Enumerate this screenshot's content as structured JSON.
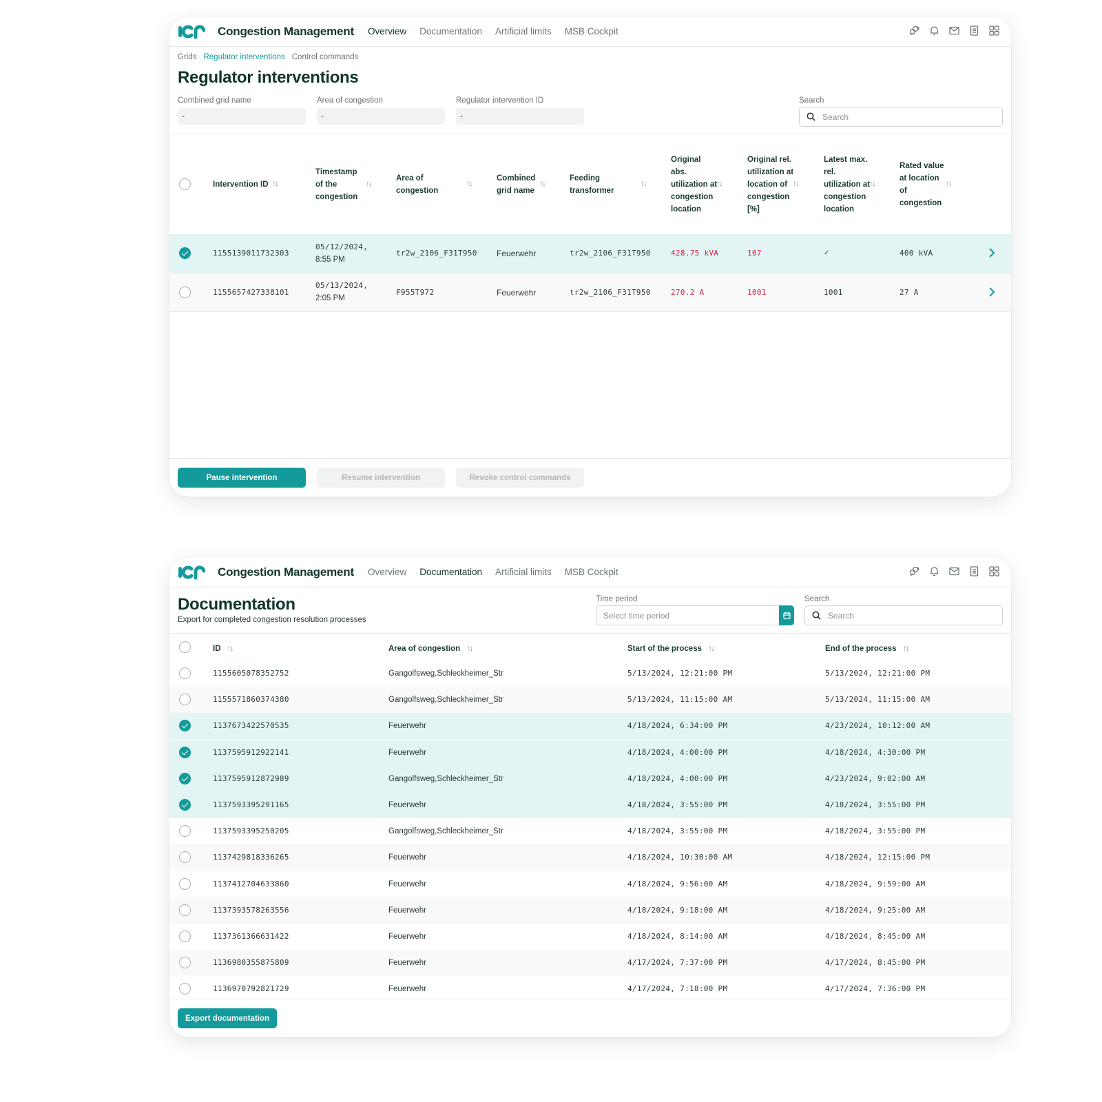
{
  "app": {
    "title": "Congestion Management",
    "logo_text": "IGP",
    "nav": [
      "Overview",
      "Documentation",
      "Artificial limits",
      "MSB Cockpit"
    ],
    "top_icons": [
      "analytics-icon",
      "bell-icon",
      "mail-icon",
      "document-icon",
      "grid-icon"
    ],
    "accent_color": "#149a9a",
    "alert_color": "#c9223f"
  },
  "screen1": {
    "active_nav": "Overview",
    "breadcrumb": [
      "Grids",
      "Regulator interventions",
      "Control commands"
    ],
    "breadcrumb_active": "Regulator interventions",
    "title": "Regulator interventions",
    "filters": [
      {
        "label": "Combined grid name",
        "value": "-"
      },
      {
        "label": "Area of congestion",
        "value": "-"
      },
      {
        "label": "Regulator intervention ID",
        "value": "-"
      }
    ],
    "search": {
      "label": "Search",
      "placeholder": "Search"
    },
    "columns": [
      "Intervention ID",
      "Timestamp of the congestion",
      "Area of congestion",
      "Combined grid name",
      "Feeding transformer",
      "Original abs. utilization at congestion location",
      "Original rel. utilization at location of congestion [%]",
      "Latest max. rel. utilization at congestion location",
      "Rated value at location of congestion"
    ],
    "rows": [
      {
        "selected": true,
        "id": "1155139011732303",
        "timestamp_date": "05/12/2024,",
        "timestamp_time": "8:55 PM",
        "area": "tr2w_2106_F31T950",
        "grid": "Feuerwehr",
        "transformer": "tr2w_2106_F31T950",
        "orig_abs": "428.75 kVA",
        "orig_rel": "107",
        "latest_rel": "✓",
        "rated": "400 kVA"
      },
      {
        "selected": false,
        "id": "1155657427338101",
        "timestamp_date": "05/13/2024,",
        "timestamp_time": "2:05 PM",
        "area": "F955T972",
        "grid": "Feuerwehr",
        "transformer": "tr2w_2106_F31T950",
        "orig_abs": "270.2 A",
        "orig_rel": "1001",
        "latest_rel": "1001",
        "rated": "27 A"
      }
    ],
    "buttons": {
      "pause": "Pause intervention",
      "resume": "Resume intervention",
      "revoke": "Revoke control commands"
    }
  },
  "screen2": {
    "active_nav": "Documentation",
    "title": "Documentation",
    "subtitle": "Export for completed congestion resolution processes",
    "time_period": {
      "label": "Time period",
      "placeholder": "Select time period"
    },
    "search": {
      "label": "Search",
      "placeholder": "Search"
    },
    "columns": [
      "ID",
      "Area of congestion",
      "Start of the process",
      "End of the process"
    ],
    "rows": [
      {
        "selected": false,
        "id": "1155605078352752",
        "area": "Gangolfsweg,Schleckheimer_Str",
        "start": "5/13/2024, 12:21:00 PM",
        "end": "5/13/2024, 12:21:00 PM"
      },
      {
        "selected": false,
        "id": "1155571860374380",
        "area": "Gangolfsweg,Schleckheimer_Str",
        "start": "5/13/2024, 11:15:00 AM",
        "end": "5/13/2024, 11:15:00 AM"
      },
      {
        "selected": true,
        "id": "1137673422570535",
        "area": "Feuerwehr",
        "start": "4/18/2024, 6:34:00 PM",
        "end": "4/23/2024, 10:12:00 AM"
      },
      {
        "selected": true,
        "id": "1137595912922141",
        "area": "Feuerwehr",
        "start": "4/18/2024, 4:00:00 PM",
        "end": "4/18/2024, 4:30:00 PM"
      },
      {
        "selected": true,
        "id": "1137595912872989",
        "area": "Gangolfsweg,Schleckheimer_Str",
        "start": "4/18/2024, 4:00:00 PM",
        "end": "4/23/2024, 9:02:00 AM"
      },
      {
        "selected": true,
        "id": "1137593395291165",
        "area": "Feuerwehr",
        "start": "4/18/2024, 3:55:00 PM",
        "end": "4/18/2024, 3:55:00 PM"
      },
      {
        "selected": false,
        "id": "1137593395250205",
        "area": "Gangolfsweg,Schleckheimer_Str",
        "start": "4/18/2024, 3:55:00 PM",
        "end": "4/18/2024, 3:55:00 PM"
      },
      {
        "selected": false,
        "id": "1137429818336265",
        "area": "Feuerwehr",
        "start": "4/18/2024, 10:30:00 AM",
        "end": "4/18/2024, 12:15:00 PM"
      },
      {
        "selected": false,
        "id": "1137412704633860",
        "area": "Feuerwehr",
        "start": "4/18/2024, 9:56:00 AM",
        "end": "4/18/2024, 9:59:00 AM"
      },
      {
        "selected": false,
        "id": "1137393578263556",
        "area": "Feuerwehr",
        "start": "4/18/2024, 9:18:00 AM",
        "end": "4/18/2024, 9:25:00 AM"
      },
      {
        "selected": false,
        "id": "1137361366631422",
        "area": "Feuerwehr",
        "start": "4/18/2024, 8:14:00 AM",
        "end": "4/18/2024, 8:45:00 AM"
      },
      {
        "selected": false,
        "id": "1136980355875809",
        "area": "Feuerwehr",
        "start": "4/17/2024, 7:37:00 PM",
        "end": "4/17/2024, 8:45:00 PM"
      },
      {
        "selected": false,
        "id": "1136970792821729",
        "area": "Feuerwehr",
        "start": "4/17/2024, 7:18:00 PM",
        "end": "4/17/2024, 7:36:00 PM"
      }
    ],
    "buttons": {
      "export": "Export documentation"
    }
  }
}
